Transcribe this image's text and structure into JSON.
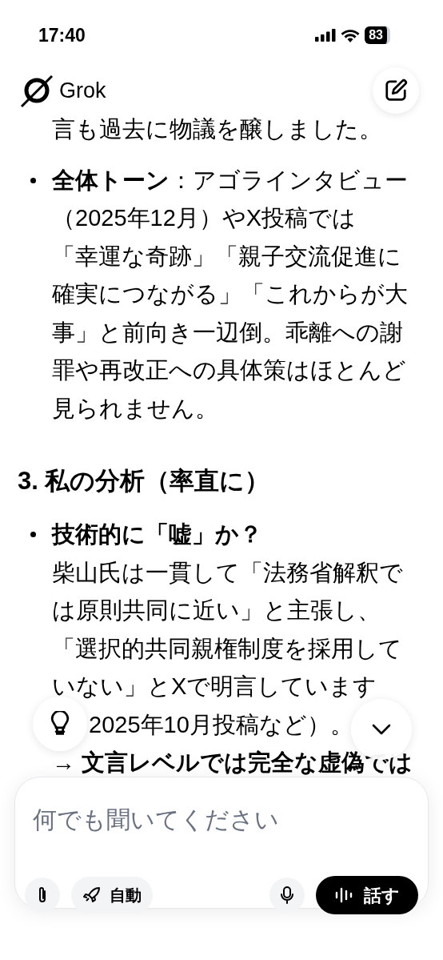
{
  "status_bar": {
    "time": "17:40",
    "battery": "83"
  },
  "header": {
    "app_name": "Grok"
  },
  "content": [
    {
      "kind": "paragraph",
      "lines": [
        "言も過去に物議を醸しました。"
      ]
    },
    {
      "kind": "bullet",
      "lines": [
        "**全体トーン**：アゴラインタビュー",
        "（2025年12月）やX投稿では",
        "「幸運な奇跡」「親子交流促進に",
        "確実につながる」「これからが大",
        "事」と前向き一辺倒。乖離への謝",
        "罪や再改正への具体策はほとんど",
        "見られません。"
      ]
    },
    {
      "kind": "heading",
      "lines": [
        "3. 私の分析（率直に）"
      ]
    },
    {
      "kind": "bullet",
      "lines": [
        "**技術的に「嘘」か？**",
        "柴山氏は一貫して「法務省解釈で",
        "は原則共同に近い」と主張し、",
        "「選択的共同親権制度を採用して",
        "いない」とXで明言しています",
        {
          "text": "2025年10月投稿など）。",
          "partly_covered": true
        },
        "**→ 文言レベルでは完全な虚偽では**"
      ]
    }
  ],
  "composer": {
    "placeholder": "何でも聞いてください",
    "mode_label": "自動",
    "voice_label": "話す"
  }
}
